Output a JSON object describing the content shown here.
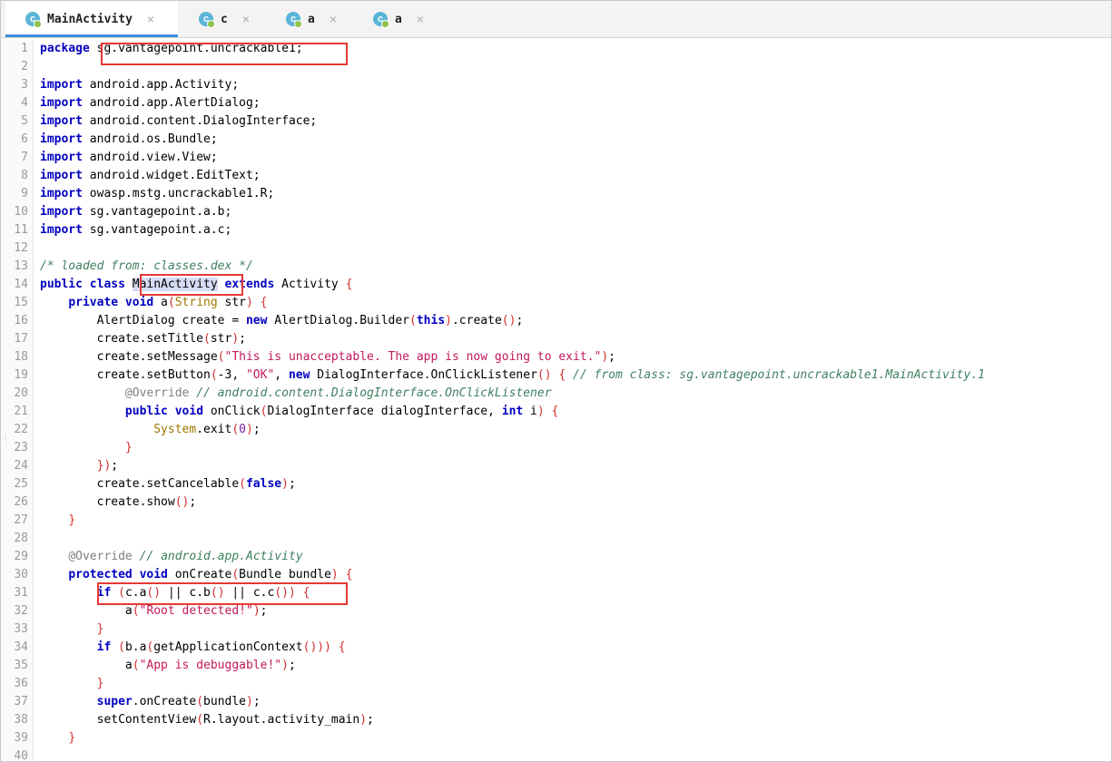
{
  "tabs": [
    {
      "label": "MainActivity",
      "icon": "class-icon",
      "active": true
    },
    {
      "label": "c",
      "icon": "class-icon",
      "active": false
    },
    {
      "label": "a",
      "icon": "class-icon",
      "active": false
    },
    {
      "label": "a",
      "icon": "class-icon",
      "active": false
    }
  ],
  "tab_close_symbol": "×",
  "lines": [
    {
      "n": "1",
      "html": "<span class=\"kw\">package</span> sg.vantagepoint.uncrackable1;"
    },
    {
      "n": "2",
      "html": ""
    },
    {
      "n": "3",
      "html": "<span class=\"kw\">import</span> android.app.Activity;"
    },
    {
      "n": "4",
      "html": "<span class=\"kw\">import</span> android.app.AlertDialog;"
    },
    {
      "n": "5",
      "html": "<span class=\"kw\">import</span> android.content.DialogInterface;"
    },
    {
      "n": "6",
      "html": "<span class=\"kw\">import</span> android.os.Bundle;"
    },
    {
      "n": "7",
      "html": "<span class=\"kw\">import</span> android.view.View;"
    },
    {
      "n": "8",
      "html": "<span class=\"kw\">import</span> android.widget.EditText;"
    },
    {
      "n": "9",
      "html": "<span class=\"kw\">import</span> owasp.mstg.uncrackable1.R;"
    },
    {
      "n": "10",
      "html": "<span class=\"kw\">import</span> sg.vantagepoint.a.b;"
    },
    {
      "n": "11",
      "html": "<span class=\"kw\">import</span> sg.vantagepoint.a.c;"
    },
    {
      "n": "12",
      "html": ""
    },
    {
      "n": "13",
      "html": "<span class=\"cm\">/* loaded from: classes.dex */</span>"
    },
    {
      "n": "14",
      "html": "<span class=\"kw\">public class</span> <span class=\"hl\">MainActivity</span> <span class=\"kw\">extends</span> Activity <span class=\"br\">{</span>"
    },
    {
      "n": "15",
      "html": "    <span class=\"kw\">private void</span> a<span class=\"br\">(</span><span class=\"ty\">String</span> str<span class=\"br\">)</span> <span class=\"br\">{</span>"
    },
    {
      "n": "16",
      "html": "        AlertDialog create = <span class=\"kw\">new</span> AlertDialog.Builder<span class=\"br\">(</span><span class=\"kw\">this</span><span class=\"br\">)</span>.create<span class=\"br\">()</span>;"
    },
    {
      "n": "17",
      "html": "        create.setTitle<span class=\"br\">(</span>str<span class=\"br\">)</span>;"
    },
    {
      "n": "18",
      "html": "        create.setMessage<span class=\"br\">(</span><span class=\"str\">\"This is unacceptable. The app is now going to exit.\"</span><span class=\"br\">)</span>;"
    },
    {
      "n": "19",
      "html": "        create.setButton<span class=\"br\">(</span>-3, <span class=\"str\">\"OK\"</span>, <span class=\"kw\">new</span> DialogInterface.OnClickListener<span class=\"br\">()</span> <span class=\"br\">{</span> <span class=\"cm\">// from class: sg.vantagepoint.uncrackable1.MainActivity.1</span>"
    },
    {
      "n": "20",
      "html": "            <span class=\"an\">@Override</span> <span class=\"cm\">// android.content.DialogInterface.OnClickListener</span>"
    },
    {
      "n": "21",
      "html": "            <span class=\"kw\">public void</span> onClick<span class=\"br\">(</span>DialogInterface dialogInterface, <span class=\"kw\">int</span> i<span class=\"br\">)</span> <span class=\"br\">{</span>"
    },
    {
      "n": "22",
      "html": "                <span class=\"sys\">System</span>.exit<span class=\"br\">(</span><span class=\"num\">0</span><span class=\"br\">)</span>;"
    },
    {
      "n": "23",
      "html": "            <span class=\"br\">}</span>"
    },
    {
      "n": "24",
      "html": "        <span class=\"br\">})</span>;"
    },
    {
      "n": "25",
      "html": "        create.setCancelable<span class=\"br\">(</span><span class=\"kw\">false</span><span class=\"br\">)</span>;"
    },
    {
      "n": "26",
      "html": "        create.show<span class=\"br\">()</span>;"
    },
    {
      "n": "27",
      "html": "    <span class=\"br\">}</span>"
    },
    {
      "n": "28",
      "html": ""
    },
    {
      "n": "29",
      "html": "    <span class=\"an\">@Override</span> <span class=\"cm\">// android.app.Activity</span>"
    },
    {
      "n": "30",
      "html": "    <span class=\"kw\">protected void</span> onCreate<span class=\"br\">(</span>Bundle bundle<span class=\"br\">)</span> <span class=\"br\">{</span>"
    },
    {
      "n": "31",
      "html": "        <span class=\"kw\">if</span> <span class=\"br\">(</span>c.a<span class=\"br\">()</span> || c.b<span class=\"br\">()</span> || c.c<span class=\"br\">())</span> <span class=\"br\">{</span>"
    },
    {
      "n": "32",
      "html": "            a<span class=\"br\">(</span><span class=\"str\">\"Root detected!\"</span><span class=\"br\">)</span>;"
    },
    {
      "n": "33",
      "html": "        <span class=\"br\">}</span>"
    },
    {
      "n": "34",
      "html": "        <span class=\"kw\">if</span> <span class=\"br\">(</span>b.a<span class=\"br\">(</span>getApplicationContext<span class=\"br\">()))</span> <span class=\"br\">{</span>"
    },
    {
      "n": "35",
      "html": "            a<span class=\"br\">(</span><span class=\"str\">\"App is debuggable!\"</span><span class=\"br\">)</span>;"
    },
    {
      "n": "36",
      "html": "        <span class=\"br\">}</span>"
    },
    {
      "n": "37",
      "html": "        <span class=\"kw\">super</span>.onCreate<span class=\"br\">(</span>bundle<span class=\"br\">)</span>;"
    },
    {
      "n": "38",
      "html": "        setContentView<span class=\"br\">(</span>R.layout.activity_main<span class=\"br\">)</span>;"
    },
    {
      "n": "39",
      "html": "    <span class=\"br\">}</span>"
    },
    {
      "n": "40",
      "html": ""
    }
  ],
  "colors": {
    "accent": "#3b8fd9",
    "annotation_box": "#e53935",
    "keyword": "#0000c0",
    "string": "#c2185b",
    "comment": "#3f7f5f"
  }
}
